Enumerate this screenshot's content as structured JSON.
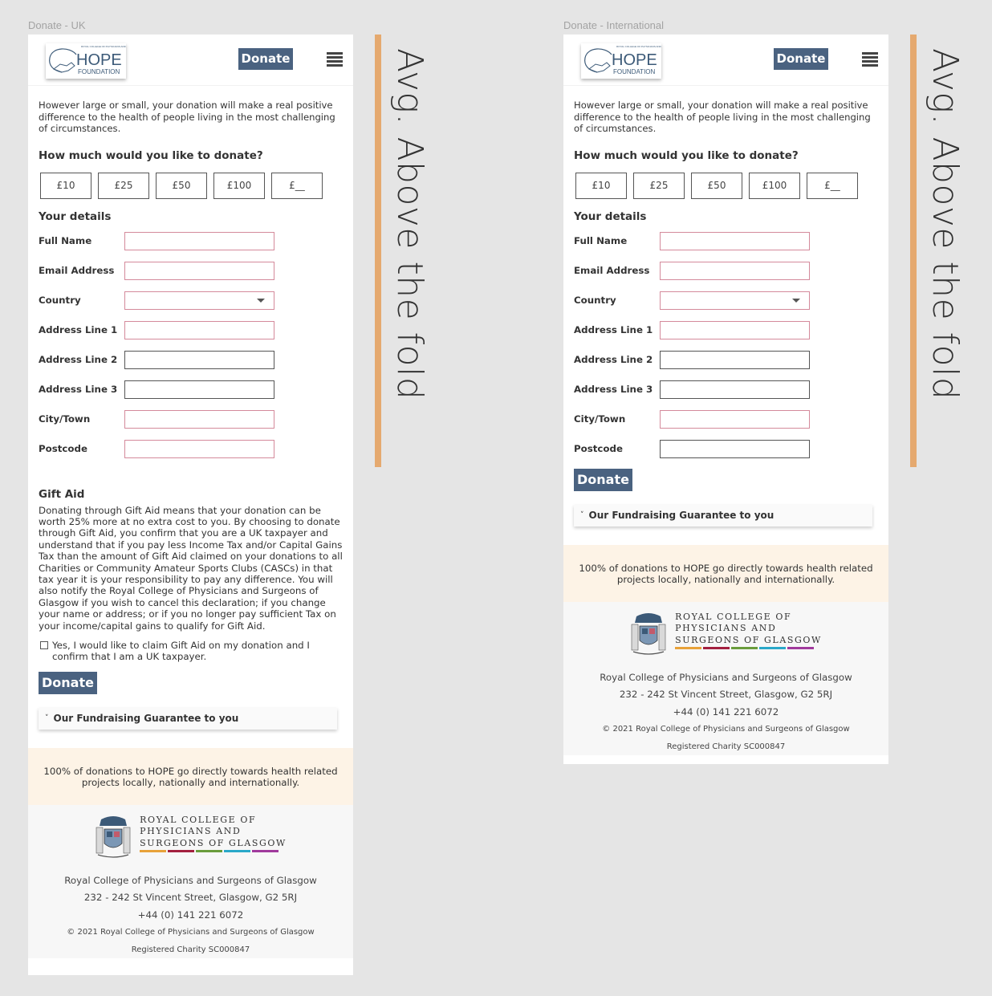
{
  "frames": [
    {
      "id": "uk",
      "frame_label": "Donate - UK",
      "header": {
        "logo": {
          "small_text": "ROYAL COLLEGE OF PHYSICIANS AND SURGEONS OF GLASGOW",
          "wordmark": "HOPE",
          "subtext": "FOUNDATION"
        },
        "donate_label": "Donate",
        "menu_icon": "hamburger-icon"
      },
      "intro": "However large or small, your donation will make a real positive difference to the health of people living in the most challenging of circumstances.",
      "amount_heading": "How much would you like to donate?",
      "amounts": [
        "£10",
        "£25",
        "£50",
        "£100",
        "£__"
      ],
      "details_heading": "Your details",
      "fields": [
        {
          "label": "Full Name",
          "value": "",
          "required": true,
          "type": "text"
        },
        {
          "label": "Email Address",
          "value": "",
          "required": true,
          "type": "text"
        },
        {
          "label": "Country",
          "value": "",
          "required": true,
          "type": "select"
        },
        {
          "label": "Address Line 1",
          "value": "",
          "required": true,
          "type": "text"
        },
        {
          "label": "Address Line 2",
          "value": "",
          "required": false,
          "type": "text"
        },
        {
          "label": "Address Line 3",
          "value": "",
          "required": false,
          "type": "text"
        },
        {
          "label": "City/Town",
          "value": "",
          "required": true,
          "type": "text"
        },
        {
          "label": "Postcode",
          "value": "",
          "required": true,
          "type": "text"
        }
      ],
      "gift_aid": {
        "heading": "Gift Aid",
        "text": "Donating through Gift Aid means that your donation can be worth 25% more at no extra cost to you. By choosing to donate through Gift Aid, you confirm that you are a UK taxpayer and understand that if you pay less Income Tax and/or Capital Gains Tax than the amount of Gift Aid claimed on your donations to all Charities or Community Amateur Sports Clubs (CASCs) in that tax year it is your responsibility to pay any difference. You will also notify the Royal College of Physicians and Surgeons of Glasgow if you wish to cancel this declaration; if you change your name or address; or if you no longer pay sufficient Tax on your income/capital gains to qualify for Gift Aid.",
        "checkbox_label": "Yes, I would like to claim Gift Aid on my donation and I confirm that I am a UK taxpayer.",
        "checked": false
      },
      "donate_button": "Donate",
      "guarantee": {
        "caret": "˅",
        "label": "Our Fundraising Guarantee to you"
      },
      "banner": "100% of donations to HOPE go directly towards health related projects locally, nationally and internationally.",
      "footer": {
        "rcps_lines": [
          "ROYAL COLLEGE OF",
          "PHYSICIANS AND",
          "SURGEONS OF GLASGOW"
        ],
        "org": "Royal College of Physicians and Surgeons of Glasgow",
        "address": "232 - 242 St Vincent Street, Glasgow, G2 5RJ",
        "phone": "+44 (0) 141 221 6072",
        "copyright": "© 2021 Royal College of Physicians and Surgeons of Glasgow",
        "charity": "Registered Charity SC000847"
      },
      "fold_annotation": "Avg. Above the fold"
    },
    {
      "id": "international",
      "frame_label": "Donate - International",
      "header": {
        "logo": {
          "small_text": "ROYAL COLLEGE OF PHYSICIANS AND SURGEONS OF GLASGOW",
          "wordmark": "HOPE",
          "subtext": "FOUNDATION"
        },
        "donate_label": "Donate",
        "menu_icon": "hamburger-icon"
      },
      "intro": "However large or small, your donation will make a real positive difference to the health of people living in the most challenging of circumstances.",
      "amount_heading": "How much would you like to donate?",
      "amounts": [
        "£10",
        "£25",
        "£50",
        "£100",
        "£__"
      ],
      "details_heading": "Your details",
      "fields": [
        {
          "label": "Full Name",
          "value": "",
          "required": true,
          "type": "text"
        },
        {
          "label": "Email Address",
          "value": "",
          "required": true,
          "type": "text"
        },
        {
          "label": "Country",
          "value": "",
          "required": true,
          "type": "select"
        },
        {
          "label": "Address Line 1",
          "value": "",
          "required": true,
          "type": "text"
        },
        {
          "label": "Address Line 2",
          "value": "",
          "required": false,
          "type": "text"
        },
        {
          "label": "Address Line 3",
          "value": "",
          "required": false,
          "type": "text"
        },
        {
          "label": "City/Town",
          "value": "",
          "required": true,
          "type": "text"
        },
        {
          "label": "Postcode",
          "value": "",
          "required": false,
          "type": "text"
        }
      ],
      "donate_button": "Donate",
      "guarantee": {
        "caret": "˅",
        "label": "Our Fundraising Guarantee to you"
      },
      "banner": "100% of donations to HOPE go directly towards health related projects locally, nationally and internationally.",
      "footer": {
        "rcps_lines": [
          "ROYAL COLLEGE OF",
          "PHYSICIANS AND",
          "SURGEONS OF GLASGOW"
        ],
        "org": "Royal College of Physicians and Surgeons of Glasgow",
        "address": "232 - 242 St Vincent Street, Glasgow, G2 5RJ",
        "phone": "+44 (0) 141 221 6072",
        "copyright": "© 2021 Royal College of Physicians and Surgeons of Glasgow",
        "charity": "Registered Charity SC000847"
      },
      "fold_annotation": "Avg. Above the fold"
    }
  ],
  "colors": {
    "brand_button": "#4a6280",
    "required_border": "#d48a9b",
    "fold_marker": "#e5a96f",
    "banner_bg": "#fdf3e6",
    "stripes": [
      "#e8a23a",
      "#a3203f",
      "#6a9c3c",
      "#2aa8c9",
      "#a03a9c"
    ]
  }
}
